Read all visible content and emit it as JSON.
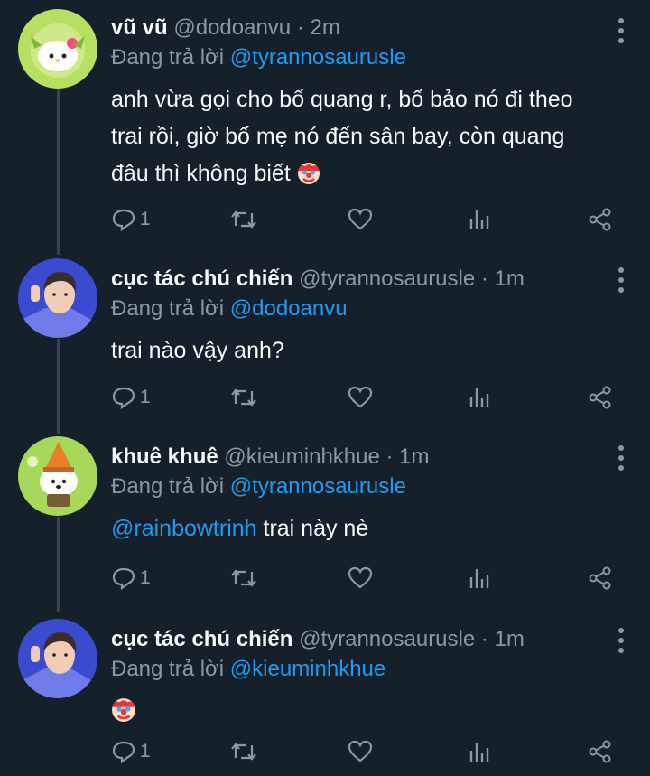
{
  "replying_prefix": "Đang trả lời",
  "tweets": [
    {
      "display_name": "vũ vũ",
      "handle": "@dodoanvu",
      "separator": "·",
      "time": "2m",
      "replying_to": "@tyrannosaurusle",
      "text": "anh vừa gọi cho bố quang r, bố bảo nó đi theo trai rồi, giờ bố mẹ nó đến sân bay, còn quang đâu thì không biết",
      "trailing_emoji": "clown",
      "reply_count": "1"
    },
    {
      "display_name": "cục tác chú chiến",
      "handle": "@tyrannosaurusle",
      "separator": "·",
      "time": "1m",
      "replying_to": "@dodoanvu",
      "text": "trai nào vậy anh?",
      "reply_count": "1"
    },
    {
      "display_name": "khuê khuê",
      "handle": "@kieuminhkhue",
      "separator": "·",
      "time": "1m",
      "replying_to": "@tyrannosaurusle",
      "mention_in_text": "@rainbowtrinh",
      "text": " trai này nè",
      "reply_count": "1"
    },
    {
      "display_name": "cục tác chú chiến",
      "handle": "@tyrannosaurusle",
      "separator": "·",
      "time": "1m",
      "replying_to": "@kieuminhkhue",
      "text": "",
      "trailing_emoji": "clown",
      "reply_count": "1"
    }
  ],
  "colors": {
    "background": "#15202b",
    "text": "#f7f9f9",
    "secondary": "#8b98a5",
    "link": "#1d9bf0",
    "thread_line": "#38444d"
  },
  "icons": [
    "reply-icon",
    "retweet-icon",
    "like-icon",
    "analytics-icon",
    "share-icon",
    "more-options-icon",
    "clown-emoji"
  ]
}
